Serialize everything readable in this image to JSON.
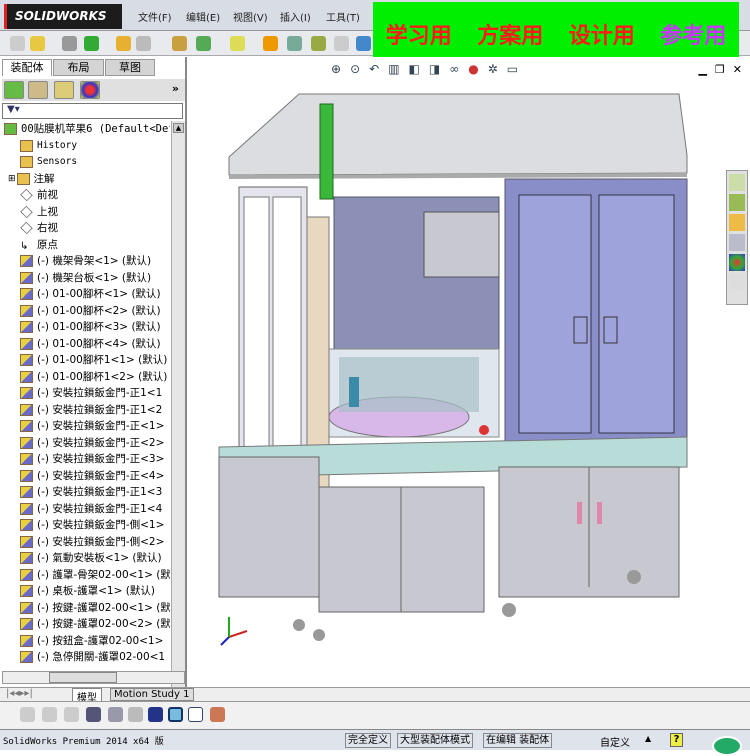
{
  "app": {
    "logo": "SOLIDWORKS"
  },
  "menu": [
    "文件(F)",
    "编辑(E)",
    "视图(V)",
    "插入(I)",
    "工具(T)"
  ],
  "banner": {
    "items": [
      {
        "text": "学习用",
        "color": "#ff1a1a"
      },
      {
        "text": "方案用",
        "color": "#ff1a1a"
      },
      {
        "text": "设计用",
        "color": "#ff1a1a"
      },
      {
        "text": "参考用",
        "color": "#cc33ff"
      }
    ]
  },
  "panel": {
    "tabs": [
      "装配体",
      "布局",
      "草图"
    ],
    "expand": "»",
    "filter_icon": "filter-icon"
  },
  "tree": {
    "root": "00贴膜机苹果6  (Default<Def",
    "items": [
      {
        "label": "History",
        "type": "history"
      },
      {
        "label": "Sensors",
        "type": "sensor"
      },
      {
        "label": "注解",
        "type": "annotation"
      },
      {
        "label": "前视",
        "type": "plane"
      },
      {
        "label": "上视",
        "type": "plane"
      },
      {
        "label": "右视",
        "type": "plane"
      },
      {
        "label": "原点",
        "type": "origin"
      },
      {
        "label": "(-) 機架骨架<1> (默认)",
        "type": "part"
      },
      {
        "label": "(-) 機架台板<1> (默认)",
        "type": "part"
      },
      {
        "label": "(-) 01-00腳杯<1> (默认)",
        "type": "part"
      },
      {
        "label": "(-) 01-00腳杯<2> (默认)",
        "type": "part"
      },
      {
        "label": "(-) 01-00腳杯<3> (默认)",
        "type": "part"
      },
      {
        "label": "(-) 01-00腳杯<4> (默认)",
        "type": "part"
      },
      {
        "label": "(-) 01-00腳杯1<1> (默认)",
        "type": "part"
      },
      {
        "label": "(-) 01-00腳杯1<2> (默认)",
        "type": "part"
      },
      {
        "label": "(-) 安裝拉鎖鈑金門-正1<1",
        "type": "part"
      },
      {
        "label": "(-) 安裝拉鎖鈑金門-正1<2",
        "type": "part"
      },
      {
        "label": "(-) 安裝拉鎖鈑金門-正<1>",
        "type": "part"
      },
      {
        "label": "(-) 安裝拉鎖鈑金門-正<2>",
        "type": "part"
      },
      {
        "label": "(-) 安裝拉鎖鈑金門-正<3>",
        "type": "part"
      },
      {
        "label": "(-) 安裝拉鎖鈑金門-正<4>",
        "type": "part"
      },
      {
        "label": "(-) 安裝拉鎖鈑金門-正1<3",
        "type": "part"
      },
      {
        "label": "(-) 安裝拉鎖鈑金門-正1<4",
        "type": "part"
      },
      {
        "label": "(-) 安裝拉鎖鈑金門-側<1>",
        "type": "part"
      },
      {
        "label": "(-) 安裝拉鎖鈑金門-側<2>",
        "type": "part"
      },
      {
        "label": "(-) 氣動安裝板<1> (默认)",
        "type": "part"
      },
      {
        "label": "(-) 護罩-骨架02-00<1> (默",
        "type": "part"
      },
      {
        "label": "(-) 桌板-護罩<1> (默认)",
        "type": "part"
      },
      {
        "label": "(-) 按鍵-護罩02-00<1> (默",
        "type": "part"
      },
      {
        "label": "(-) 按鍵-護罩02-00<2> (默",
        "type": "part"
      },
      {
        "label": "(-) 按鈕盒-護罩02-00<1>",
        "type": "part"
      },
      {
        "label": "(-) 急停開關-護罩02-00<1",
        "type": "part"
      }
    ]
  },
  "bottom_tabs": [
    "模型",
    "Motion Study 1"
  ],
  "status": {
    "version": "SolidWorks Premium 2014 x64 版",
    "defined": "完全定义",
    "mode": "大型装配体模式",
    "editing": "在编辑 装配体",
    "custom": "自定义",
    "help": "?"
  }
}
